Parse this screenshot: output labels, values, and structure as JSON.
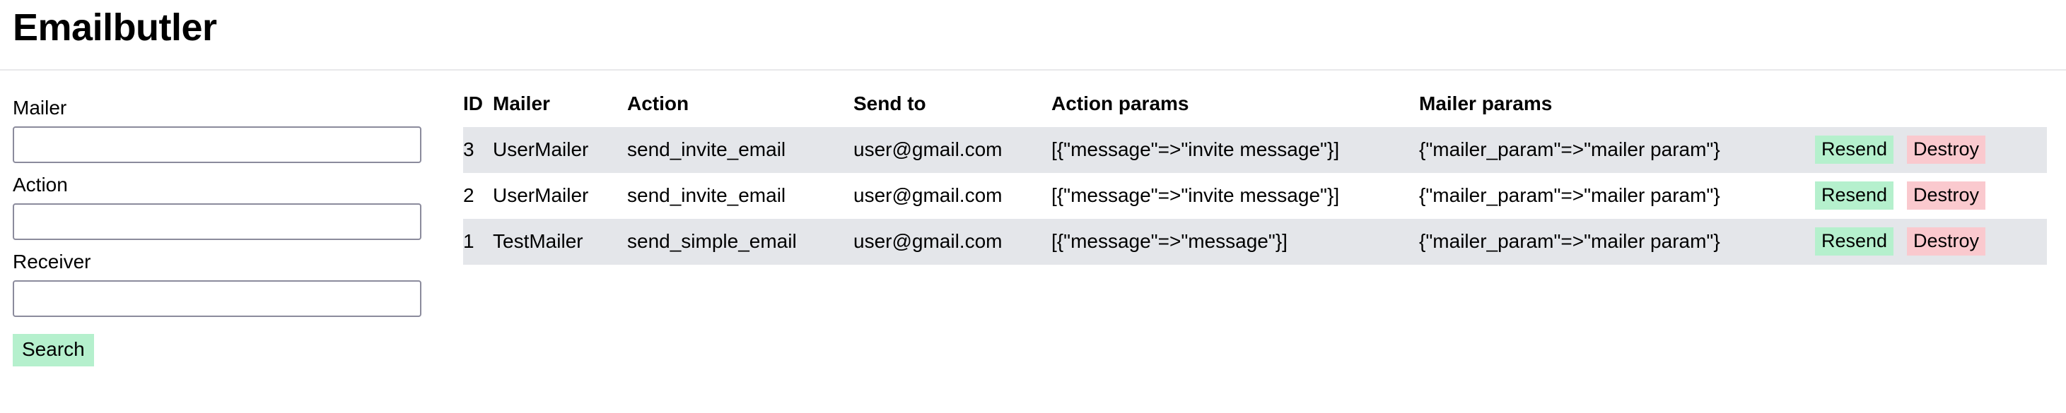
{
  "app": {
    "title": "Emailbutler"
  },
  "search_form": {
    "fields": [
      {
        "label": "Mailer",
        "value": "",
        "placeholder": ""
      },
      {
        "label": "Action",
        "value": "",
        "placeholder": ""
      },
      {
        "label": "Receiver",
        "value": "",
        "placeholder": ""
      }
    ],
    "submit_label": "Search"
  },
  "table": {
    "columns": [
      "ID",
      "Mailer",
      "Action",
      "Send to",
      "Action params",
      "Mailer params"
    ],
    "row_actions": {
      "resend_label": "Resend",
      "destroy_label": "Destroy"
    },
    "rows": [
      {
        "id": "3",
        "mailer": "UserMailer",
        "action": "send_invite_email",
        "send_to": "user@gmail.com",
        "action_params": "[{\"message\"=>\"invite message\"}]",
        "mailer_params": "{\"mailer_param\"=>\"mailer param\"}",
        "resend_label": "Resend",
        "destroy_label": "Destroy"
      },
      {
        "id": "2",
        "mailer": "UserMailer",
        "action": "send_invite_email",
        "send_to": "user@gmail.com",
        "action_params": "[{\"message\"=>\"invite message\"}]",
        "mailer_params": "{\"mailer_param\"=>\"mailer param\"}",
        "resend_label": "Resend",
        "destroy_label": "Destroy"
      },
      {
        "id": "1",
        "mailer": "TestMailer",
        "action": "send_simple_email",
        "send_to": "user@gmail.com",
        "action_params": "[{\"message\"=>\"message\"}]",
        "mailer_params": "{\"mailer_param\"=>\"mailer param\"}",
        "resend_label": "Resend",
        "destroy_label": "Destroy"
      }
    ]
  },
  "colors": {
    "resend_bg": "#b5f0cd",
    "destroy_bg": "#fac9ce",
    "row_stripe_bg": "#e4e6ea",
    "input_border": "#8b8b9c",
    "header_rule": "#e8e8ea"
  }
}
